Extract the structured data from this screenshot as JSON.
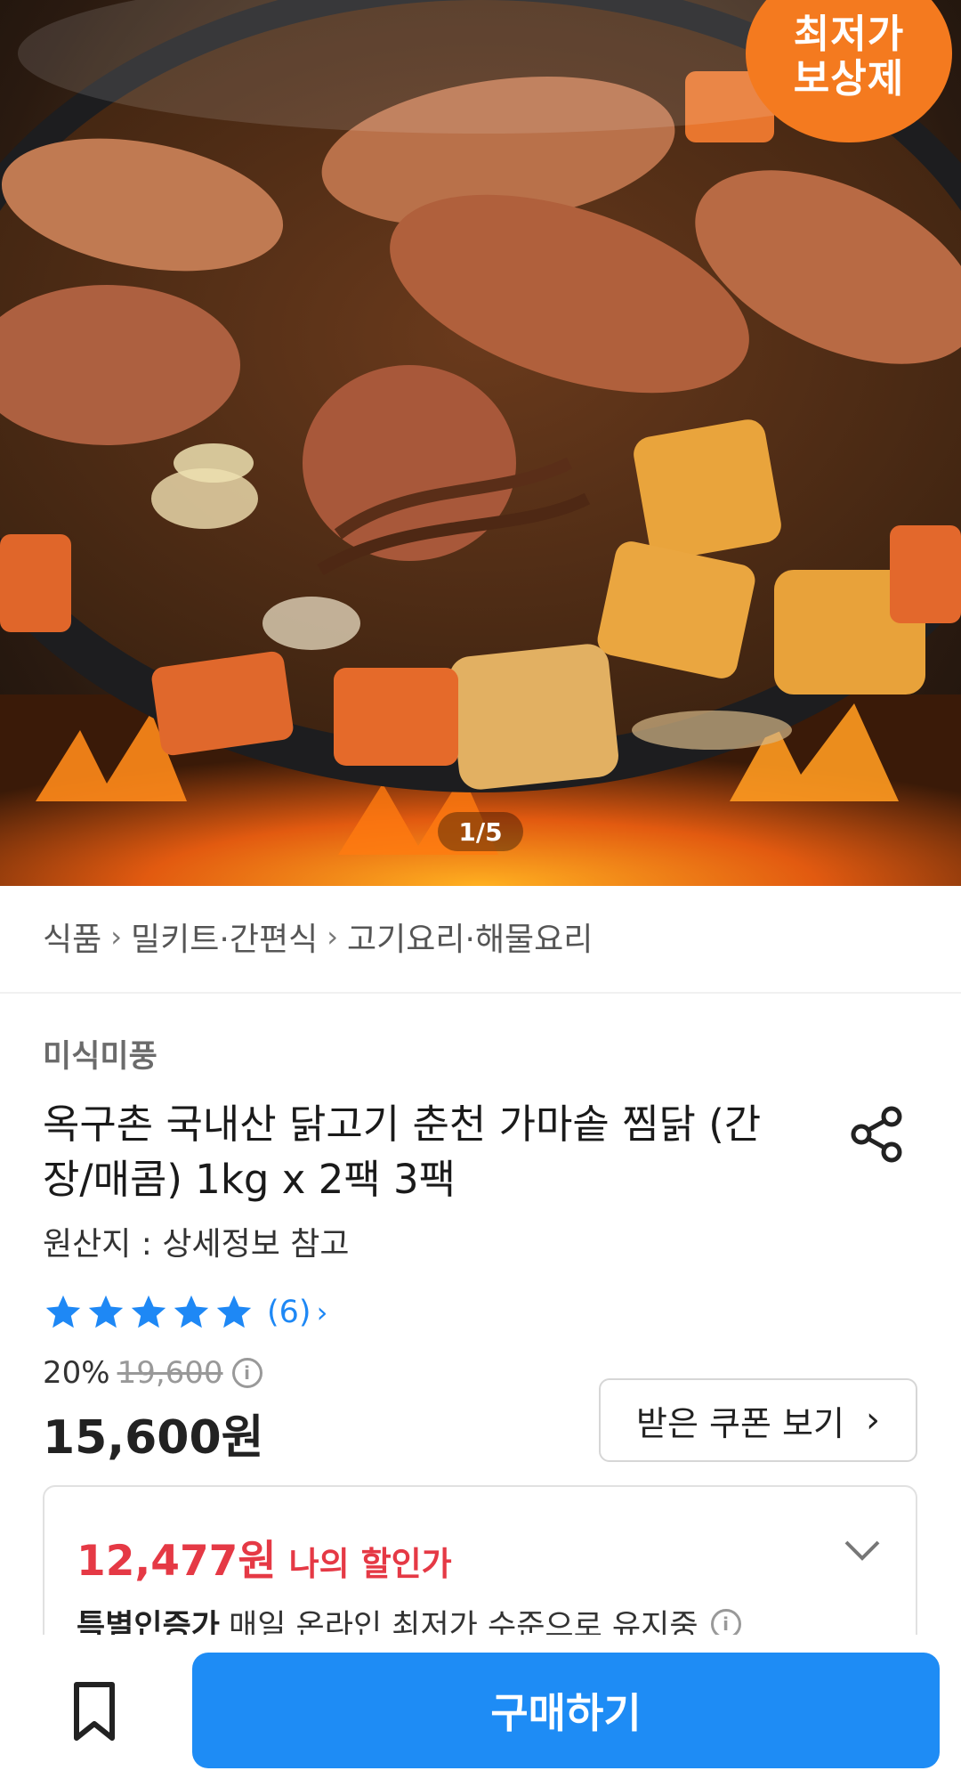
{
  "hero": {
    "badge_line1": "최저가",
    "badge_line2": "보상제",
    "image_counter": "1/5"
  },
  "breadcrumb": [
    "식품",
    "밀키트·간편식",
    "고기요리·해물요리"
  ],
  "product": {
    "brand": "미식미풍",
    "title": "옥구촌 국내산 닭고기 춘천 가마솥 찜닭 (간장/매콤) 1kg x 2팩 3팩",
    "origin": "원산지 : 상세정보 참고",
    "rating_stars": 5,
    "review_count": "(6)",
    "discount_rate": "20%",
    "original_price": "19,600",
    "price": "15,600원"
  },
  "coupon": {
    "label": "받은 쿠폰 보기"
  },
  "my_discount": {
    "amount": "12,477원",
    "label": "나의 할인가",
    "cert_bold": "특별인증가",
    "cert_text": "매일 온라인 최저가 수준으로 유지중"
  },
  "bottom": {
    "buy_label": "구매하기"
  },
  "colors": {
    "accent": "#1e8cf5",
    "sale_red": "#e53945",
    "badge_orange": "#f47a1f",
    "star_blue": "#1e88f5"
  },
  "icons": [
    "share-icon",
    "star-icon",
    "info-icon",
    "chevron-right-icon",
    "chevron-down-icon",
    "bookmark-icon"
  ]
}
